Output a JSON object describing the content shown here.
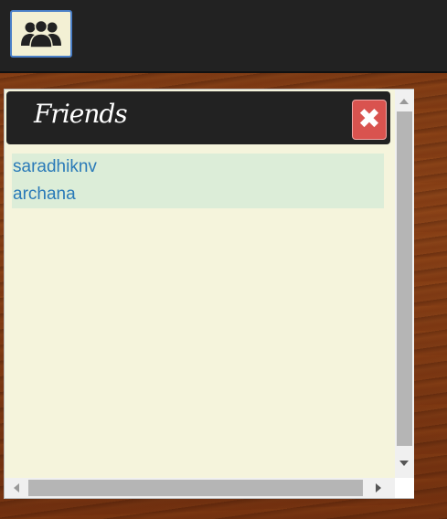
{
  "topbar": {
    "friends_toggle_icon": "users-icon"
  },
  "panel": {
    "title": "Friends",
    "close_icon": "close-icon",
    "close_glyph": "✖",
    "friends": [
      {
        "name": "saradhiknv"
      },
      {
        "name": "archana"
      }
    ]
  },
  "colors": {
    "topbar_bg": "#222222",
    "panel_bg": "#f5f4dc",
    "list_item_bg": "#dcedd8",
    "link_text": "#2a7ab8",
    "close_button": "#d9534f"
  }
}
